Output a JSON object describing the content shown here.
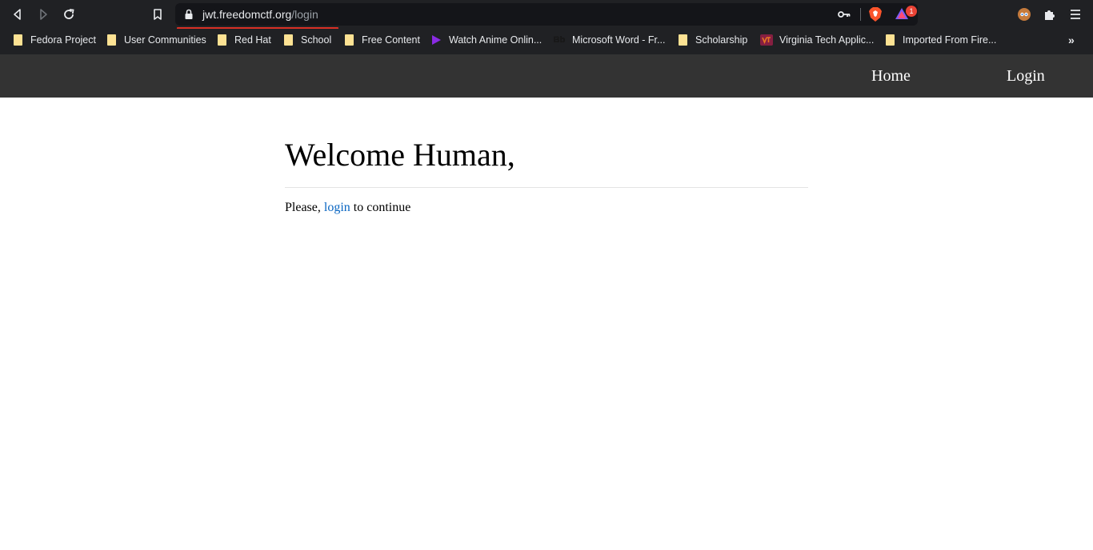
{
  "browser": {
    "url_host": "jwt.freedomctf.org",
    "url_path": "/login",
    "rewards_count": "1",
    "bookmarks": [
      {
        "label": "Fedora Project",
        "icon": "folder-icon"
      },
      {
        "label": "User Communities",
        "icon": "folder-icon"
      },
      {
        "label": "Red Hat",
        "icon": "folder-icon"
      },
      {
        "label": "School",
        "icon": "folder-icon"
      },
      {
        "label": "Free Content",
        "icon": "folder-icon"
      },
      {
        "label": "Watch Anime Onlin...",
        "icon": "play-icon"
      },
      {
        "label": "Microsoft Word - Fr...",
        "icon": "bb-icon"
      },
      {
        "label": "Scholarship",
        "icon": "folder-icon"
      },
      {
        "label": "Virginia Tech Applic...",
        "icon": "vt-icon"
      },
      {
        "label": "Imported From Fire...",
        "icon": "folder-icon"
      }
    ],
    "more_bookmarks": "»"
  },
  "site": {
    "nav": {
      "home": "Home",
      "login": "Login"
    },
    "heading": "Welcome Human,",
    "message_before": "Please,",
    "message_link": "login",
    "message_after": "to continue"
  },
  "colors": {
    "chrome_bg": "#202124",
    "nav_bg": "#333333",
    "link": "#0a66c2",
    "load_bar": "#d93025"
  }
}
